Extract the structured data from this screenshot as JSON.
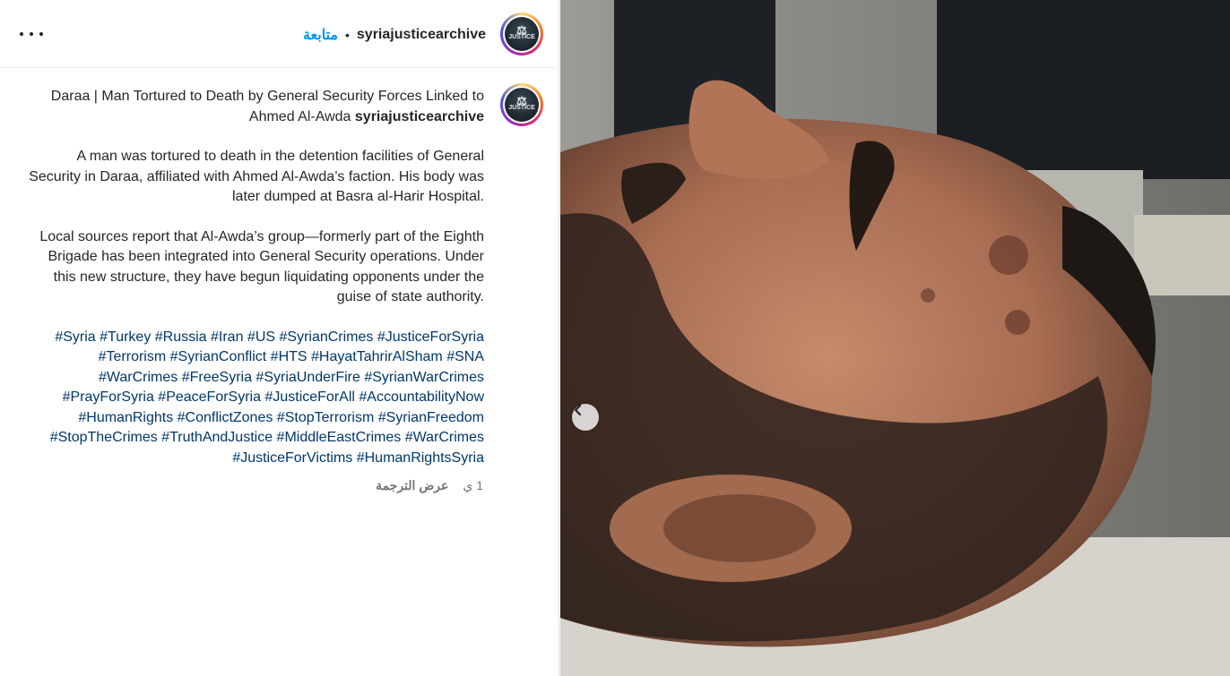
{
  "header": {
    "username": "syriajusticearchive",
    "separator": "•",
    "follow_label": "متابعة",
    "more_icon": "more-horizontal-icon"
  },
  "avatar": {
    "text": "JUSTICE"
  },
  "post": {
    "username": "syriajusticearchive",
    "title": "Daraa | Man Tortured to Death by General Security Forces Linked to Ahmed Al-Awda",
    "paragraph1": "A man was tortured to death in the detention facilities of General Security in Daraa, affiliated with Ahmed Al-Awda’s faction. His body was later dumped at Basra al-Harir Hospital.",
    "paragraph2": "Local sources report that Al-Awda’s group—formerly part of the Eighth Brigade has been integrated into General Security operations. Under this new structure, they have begun liquidating opponents under the guise of state authority.",
    "hashtags": "#Syria #Turkey #Russia #Iran #US #SyrianCrimes #JusticeForSyria #Terrorism #SyrianConflict #HTS #HayatTahrirAlSham #SNA #WarCrimes #FreeSyria #SyriaUnderFire #SyrianWarCrimes #PrayForSyria #PeaceForSyria #JusticeForAll #AccountabilityNow #HumanRights #ConflictZones #StopTerrorism #SyrianFreedom #StopTheCrimes #TruthAndJustice #MiddleEastCrimes #WarCrimes #JusticeForVictims #HumanRightsSyria",
    "time": "1 ي",
    "translate_label": "عرض الترجمة"
  },
  "media": {
    "prev_icon": "chevron-left-icon"
  },
  "colors": {
    "follow": "#0095f6",
    "hashtag": "#00376b",
    "meta": "#737373"
  }
}
